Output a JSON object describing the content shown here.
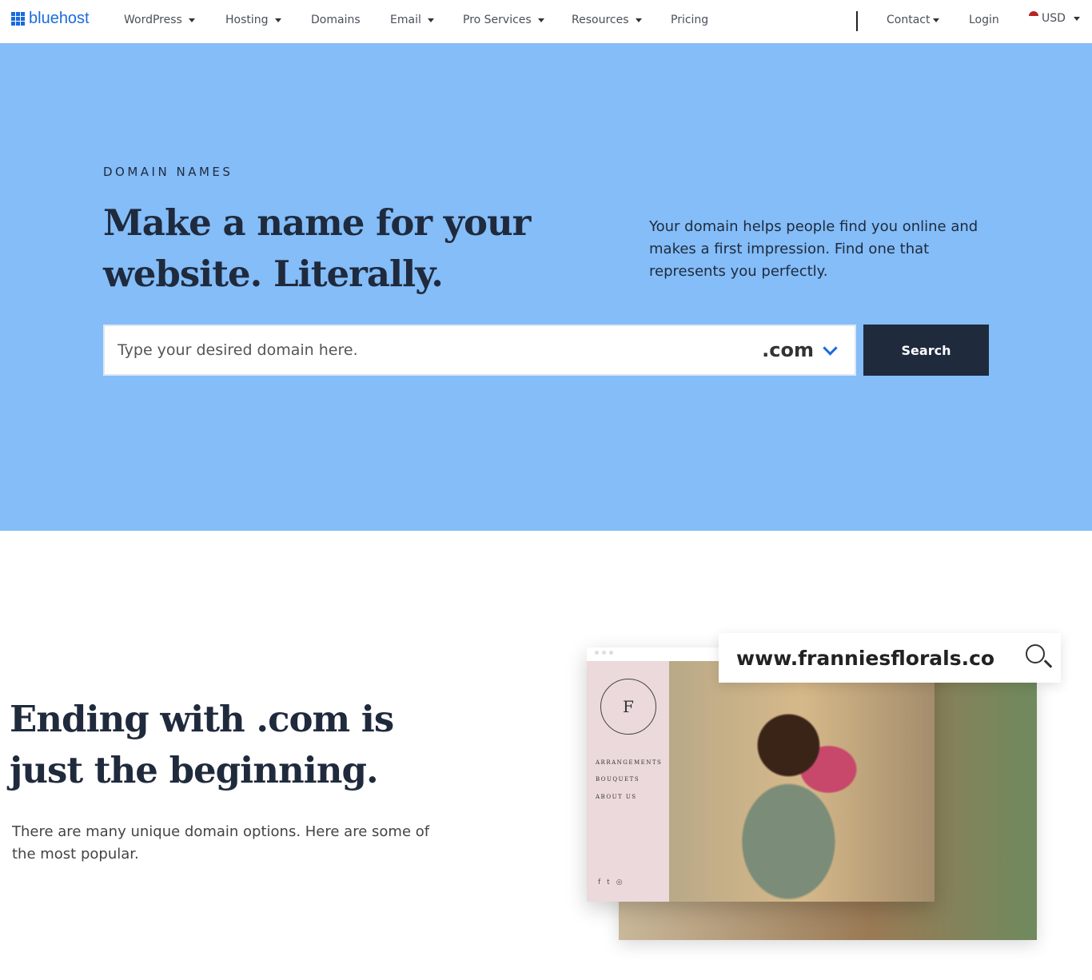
{
  "nav": {
    "logo": "bluehost",
    "items": [
      {
        "label": "WordPress",
        "dropdown": true
      },
      {
        "label": "Hosting",
        "dropdown": true
      },
      {
        "label": "Domains",
        "dropdown": false
      },
      {
        "label": "Email",
        "dropdown": true
      },
      {
        "label": "Pro Services",
        "dropdown": true
      },
      {
        "label": "Resources",
        "dropdown": true
      },
      {
        "label": "Pricing",
        "dropdown": false
      }
    ],
    "contact": "Contact",
    "login": "Login",
    "currency": "USD",
    "brand_color": "#196bde"
  },
  "hero": {
    "kicker": "DOMAIN NAMES",
    "title": "Make a name for your website. Literally.",
    "lede": "Your domain helps people find you online and makes a first impression. Find one that represents you perfectly.",
    "search_placeholder": "Type your desired domain here.",
    "tld": ".com",
    "search_button": "Search",
    "bg_color": "#84bdf8"
  },
  "section": {
    "title": "Ending with .com is just the beginning.",
    "text": "There are many unique domain options. Here are some of the most popular.",
    "mockup": {
      "url": "www.franniesflorals.co",
      "logo_letter": "F",
      "menu": [
        "ARRANGEMENTS",
        "BOUQUETS",
        "ABOUT US"
      ]
    }
  }
}
